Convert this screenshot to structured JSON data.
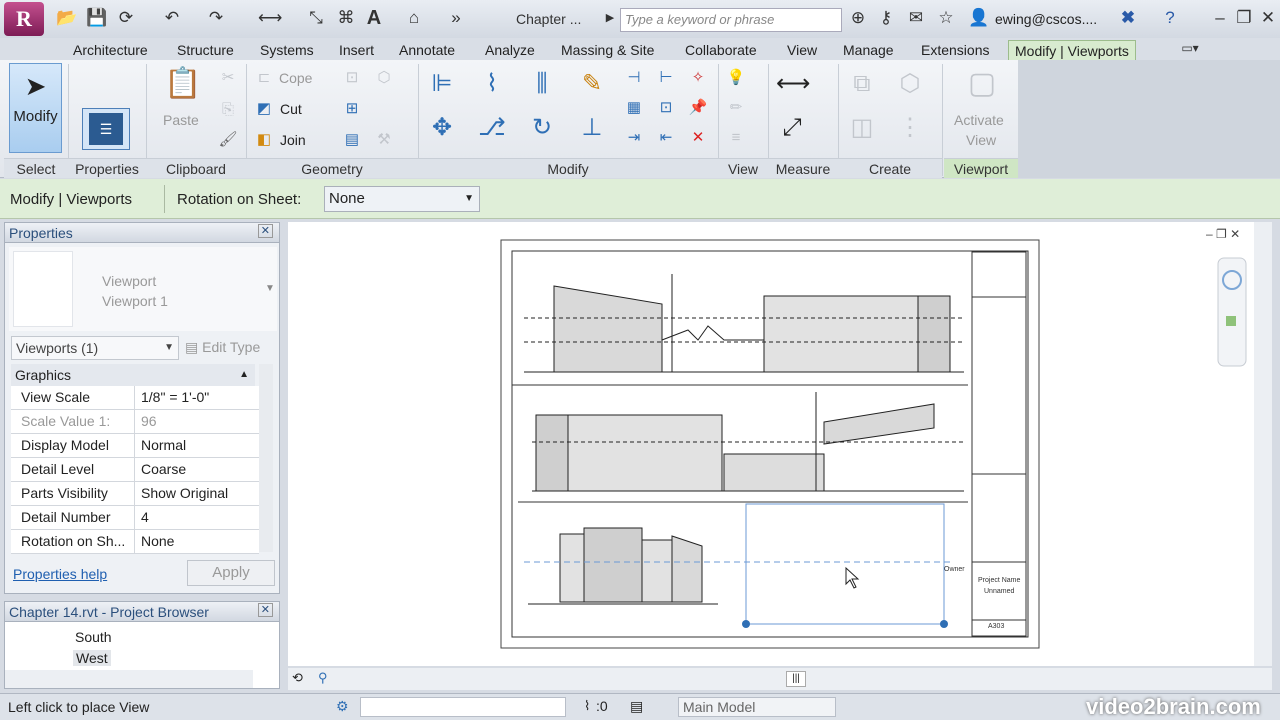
{
  "qat": {
    "doc_title": "Chapter ...",
    "search_placeholder": "Type a keyword or phrase",
    "user": "ewing@cscos...."
  },
  "tabs": [
    "Architecture",
    "Structure",
    "Systems",
    "Insert",
    "Annotate",
    "Analyze",
    "Massing & Site",
    "Collaborate",
    "View",
    "Manage",
    "Extensions",
    "Modify | Viewports"
  ],
  "ribbon": {
    "modify_label": "Modify",
    "paste_label": "Paste",
    "cope_label": "Cope",
    "cut_label": "Cut",
    "join_label": "Join",
    "activate_label_1": "Activate",
    "activate_label_2": "View",
    "panels": [
      "Select",
      "Properties",
      "Clipboard",
      "Geometry",
      "Modify",
      "View",
      "Measure",
      "Create",
      "Viewport"
    ]
  },
  "optionsbar": {
    "context": "Modify | Viewports",
    "rotation_label": "Rotation on Sheet:",
    "rotation_value": "None"
  },
  "properties": {
    "title": "Properties",
    "type_line1": "Viewport",
    "type_line2": "Viewport 1",
    "selector": "Viewports (1)",
    "edit_type": "Edit Type",
    "group": "Graphics",
    "rows": [
      {
        "k": "View Scale",
        "v": "1/8\" = 1'-0\""
      },
      {
        "k": "Scale Value    1:",
        "v": "96"
      },
      {
        "k": "Display Model",
        "v": "Normal"
      },
      {
        "k": "Detail Level",
        "v": "Coarse"
      },
      {
        "k": "Parts Visibility",
        "v": "Show Original"
      },
      {
        "k": "Detail Number",
        "v": "4"
      },
      {
        "k": "Rotation on Sh...",
        "v": "None"
      }
    ],
    "help": "Properties help",
    "apply": "Apply"
  },
  "browser": {
    "title": "Chapter 14.rvt - Project Browser",
    "items": [
      "South",
      "West"
    ]
  },
  "sheet": {
    "titleblock_owner": "Owner",
    "titleblock_project": "Project Name",
    "titleblock_unnamed": "Unnamed",
    "sheet_number": "A303"
  },
  "status": {
    "message": "Left click to place View",
    "selection_count": ":0",
    "model": "Main Model"
  },
  "watermark": "video2brain.com"
}
